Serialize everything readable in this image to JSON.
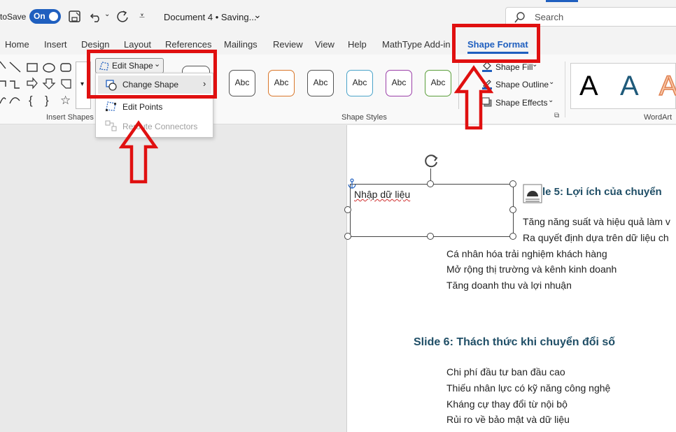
{
  "titlebar": {
    "autosave_label": "toSave",
    "autosave_state": "On",
    "doc_title": "Document 4 • Saving...",
    "search_placeholder": "Search"
  },
  "tabs": [
    {
      "label": "Home"
    },
    {
      "label": "Insert"
    },
    {
      "label": "Design"
    },
    {
      "label": "Layout"
    },
    {
      "label": "References"
    },
    {
      "label": "Mailings"
    },
    {
      "label": "Review"
    },
    {
      "label": "View"
    },
    {
      "label": "Help"
    },
    {
      "label": "MathType Add-in"
    },
    {
      "label": "Shape Format",
      "active": true
    }
  ],
  "ribbon": {
    "edit_shape_label": "Edit Shape",
    "insert_shapes_label": "Insert Shapes",
    "shape_styles_label": "Shape Styles",
    "wordart_label": "WordArt",
    "style_sample": "Abc",
    "style_colors": [
      "#555555",
      "#1f6fa8",
      "#d9772b",
      "#555555",
      "#4aa3c9",
      "#9b3fa8",
      "#5a9e3a"
    ],
    "shape_fill_label": "Shape Fill",
    "shape_outline_label": "Shape Outline",
    "shape_effects_label": "Shape Effects",
    "wordart_sample": "A",
    "wordart_colors": [
      "#000000",
      "#1f5a7a",
      "#f0a070"
    ]
  },
  "dropdown": {
    "change_shape": "Change Shape",
    "edit_points": "Edit Points",
    "reroute_connectors": "Reroute Connectors"
  },
  "document": {
    "textbox_text": "Nhập dữ liệu",
    "slide5_heading_partial": "le 5: Lợi ích của chuyển",
    "slide5_lines_right": [
      "Tăng năng suất và hiệu quả làm v",
      "Ra quyết định dựa trên dữ liệu ch"
    ],
    "slide5_lines": [
      "Cá nhân hóa trải nghiệm khách hàng",
      "Mở rộng thị trường và kênh kinh doanh",
      "Tăng doanh thu và lợi nhuận"
    ],
    "slide6_heading": "Slide 6: Thách thức khi chuyển đổi số",
    "slide6_lines": [
      "Chi phí đầu tư ban đầu cao",
      "Thiếu nhân lực có kỹ năng công nghệ",
      "Kháng cự thay đổi từ nội bộ",
      "Rủi ro về bảo mật và dữ liệu"
    ]
  },
  "colors": {
    "accent": "#1f5fbf",
    "annotation_red": "#e01010",
    "heading": "#1f4e66"
  }
}
